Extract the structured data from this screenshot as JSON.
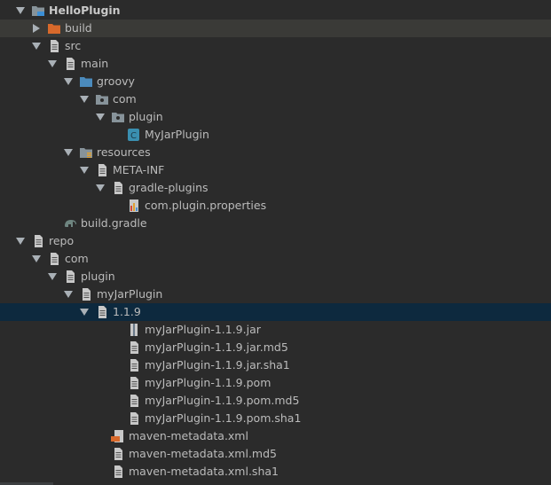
{
  "project_tree": {
    "items": [
      {
        "label": "HelloPlugin",
        "depth": 0,
        "expanded": true,
        "icon": "project-folder-icon",
        "bold": true
      },
      {
        "label": "build",
        "depth": 1,
        "expanded": false,
        "icon": "orange-folder-icon"
      },
      {
        "label": "src",
        "depth": 1,
        "expanded": true,
        "icon": "folder-icon"
      },
      {
        "label": "main",
        "depth": 2,
        "expanded": true,
        "icon": "folder-icon"
      },
      {
        "label": "groovy",
        "depth": 3,
        "expanded": true,
        "icon": "source-folder-icon"
      },
      {
        "label": "com",
        "depth": 4,
        "expanded": true,
        "icon": "package-icon"
      },
      {
        "label": "plugin",
        "depth": 5,
        "expanded": true,
        "icon": "package-icon"
      },
      {
        "label": "MyJarPlugin",
        "depth": 6,
        "leaf": true,
        "icon": "groovy-class-icon",
        "icon_text": "C"
      },
      {
        "label": "resources",
        "depth": 3,
        "expanded": true,
        "icon": "resources-folder-icon"
      },
      {
        "label": "META-INF",
        "depth": 4,
        "expanded": true,
        "icon": "folder-icon"
      },
      {
        "label": "gradle-plugins",
        "depth": 5,
        "expanded": true,
        "icon": "folder-icon"
      },
      {
        "label": "com.plugin.properties",
        "depth": 6,
        "leaf": true,
        "icon": "properties-file-icon"
      },
      {
        "label": "build.gradle",
        "depth": 2,
        "leaf": true,
        "icon": "gradle-elephant-icon"
      },
      {
        "label": "repo",
        "depth": 0,
        "expanded": true,
        "icon": "folder-icon"
      },
      {
        "label": "com",
        "depth": 1,
        "expanded": true,
        "icon": "folder-icon"
      },
      {
        "label": "plugin",
        "depth": 2,
        "expanded": true,
        "icon": "folder-icon"
      },
      {
        "label": "myJarPlugin",
        "depth": 3,
        "expanded": true,
        "icon": "folder-icon"
      },
      {
        "label": "1.1.9",
        "depth": 4,
        "expanded": true,
        "icon": "folder-icon"
      },
      {
        "label": "myJarPlugin-1.1.9.jar",
        "depth": 6,
        "leaf": true,
        "icon": "jar-file-icon"
      },
      {
        "label": "myJarPlugin-1.1.9.jar.md5",
        "depth": 6,
        "leaf": true,
        "icon": "text-file-icon"
      },
      {
        "label": "myJarPlugin-1.1.9.jar.sha1",
        "depth": 6,
        "leaf": true,
        "icon": "text-file-icon"
      },
      {
        "label": "myJarPlugin-1.1.9.pom",
        "depth": 6,
        "leaf": true,
        "icon": "text-file-icon"
      },
      {
        "label": "myJarPlugin-1.1.9.pom.md5",
        "depth": 6,
        "leaf": true,
        "icon": "text-file-icon"
      },
      {
        "label": "myJarPlugin-1.1.9.pom.sha1",
        "depth": 6,
        "leaf": true,
        "icon": "text-file-icon"
      },
      {
        "label": "maven-metadata.xml",
        "depth": 5,
        "leaf": true,
        "icon": "xml-file-icon"
      },
      {
        "label": "maven-metadata.xml.md5",
        "depth": 5,
        "leaf": true,
        "icon": "text-file-icon"
      },
      {
        "label": "maven-metadata.xml.sha1",
        "depth": 5,
        "leaf": true,
        "icon": "text-file-icon"
      }
    ],
    "highlighted_label": "build",
    "selected_label": "1.1.9"
  },
  "colors": {
    "background": "#2b2b2b",
    "text": "#bbbbbb",
    "selection": "#0d293e",
    "hover": "#3a3a37",
    "folder": "#87939a",
    "orange_folder": "#d8692b",
    "groovy_class": "#3a8fb0",
    "source_folder": "#4b8bbd"
  }
}
